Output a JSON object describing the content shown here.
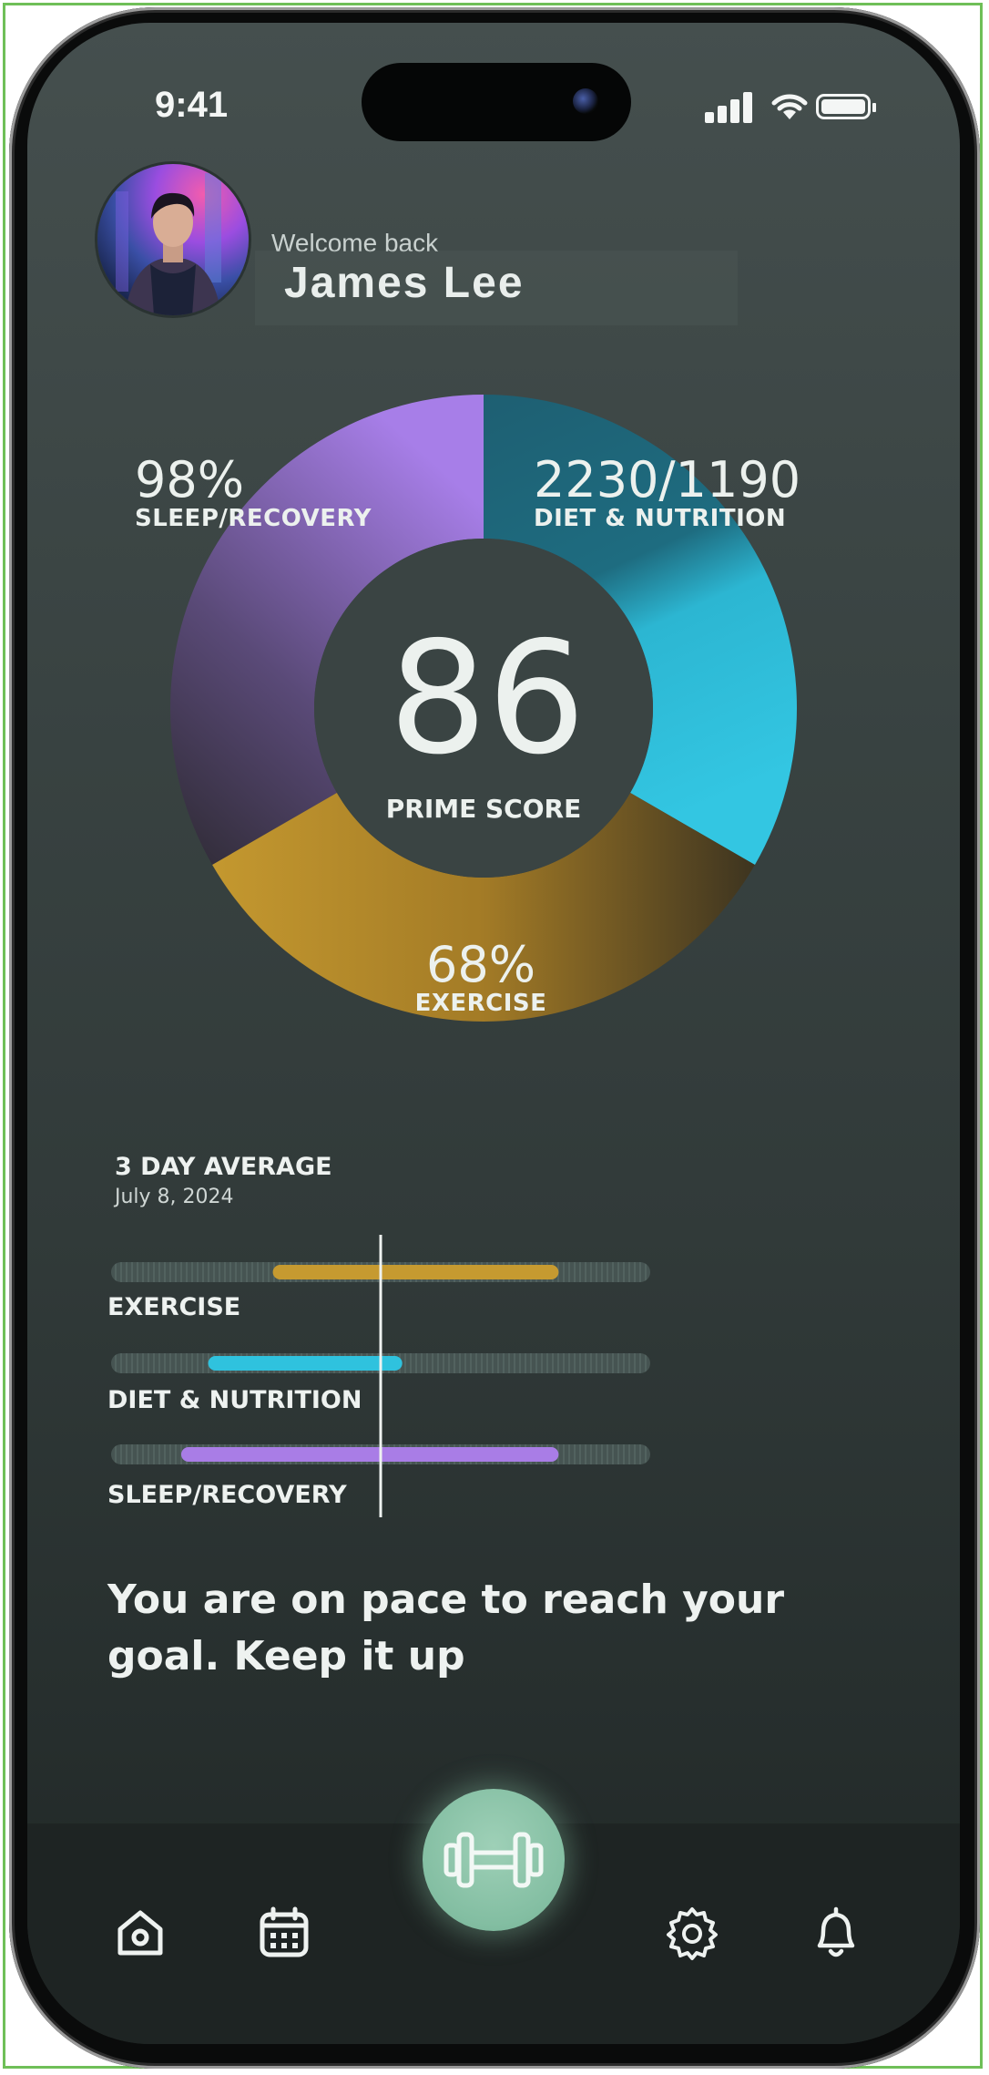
{
  "status_bar": {
    "time": "9:41",
    "icons": [
      "cellular-signal-icon",
      "wifi-icon",
      "battery-icon"
    ]
  },
  "header": {
    "welcome": "Welcome back",
    "name": "James  Lee",
    "avatar": "user-avatar-illustration"
  },
  "chart_data": [
    {
      "type": "pie",
      "title": "PRIME SCORE",
      "center_value": "86",
      "slices": [
        {
          "name": "SLEEP/RECOVERY",
          "label": "98%",
          "color": "#a97de6"
        },
        {
          "name": "DIET & NUTRITION",
          "label": "2230/1190",
          "color": "#2fc2de"
        },
        {
          "name": "EXERCISE",
          "label": "68%",
          "color": "#c69a30"
        }
      ]
    },
    {
      "type": "bar",
      "title": "3 DAY AVERAGE",
      "subtitle": "July 8, 2024",
      "categories": [
        "EXERCISE",
        "DIET & NUTRITION",
        "SLEEP/RECOVERY"
      ],
      "ranges": [
        [
          0.3,
          0.83
        ],
        [
          0.18,
          0.54
        ],
        [
          0.13,
          0.83
        ]
      ],
      "marker": 0.5,
      "colors": [
        "#c69a30",
        "#2fc2de",
        "#a97de6"
      ]
    }
  ],
  "message": "You are on pace to reach your goal. Keep it up",
  "nav": {
    "items": [
      "home-icon",
      "calendar-icon",
      "settings-icon",
      "bell-icon"
    ],
    "fab": "dumbbell-icon"
  }
}
